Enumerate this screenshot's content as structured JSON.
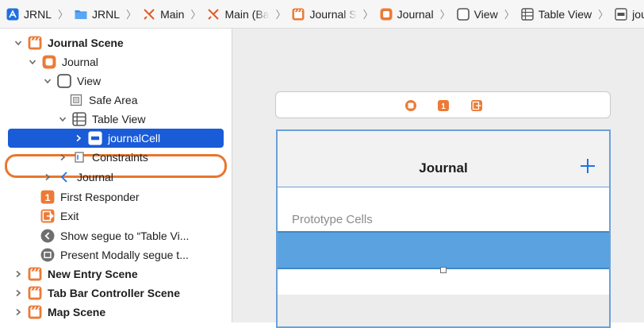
{
  "breadcrumb": [
    {
      "label": "JRNL",
      "icon": "xcode-project-icon"
    },
    {
      "label": "JRNL",
      "icon": "folder-icon"
    },
    {
      "label": "Main",
      "icon": "storyboard-icon"
    },
    {
      "label": "Main (Ba",
      "icon": "storyboard-icon"
    },
    {
      "label": "Journal S",
      "icon": "scene-icon"
    },
    {
      "label": "Journal",
      "icon": "view-controller-icon"
    },
    {
      "label": "View",
      "icon": "view-icon"
    },
    {
      "label": "Table View",
      "icon": "table-view-icon"
    },
    {
      "label": "journalCell",
      "icon": "table-cell-icon"
    }
  ],
  "outline": {
    "items": [
      {
        "label": "Journal Scene",
        "icon": "scene-icon",
        "disclosure": "open",
        "bold": true
      },
      {
        "label": "Journal",
        "icon": "view-controller-icon",
        "disclosure": "open"
      },
      {
        "label": "View",
        "icon": "view-icon",
        "disclosure": "open"
      },
      {
        "label": "Safe Area",
        "icon": "safe-area-icon",
        "disclosure": "none"
      },
      {
        "label": "Table View",
        "icon": "table-view-icon",
        "disclosure": "open"
      },
      {
        "label": "journalCell",
        "icon": "table-cell-icon",
        "disclosure": "closed",
        "selected": true
      },
      {
        "label": "Constraints",
        "icon": "constraints-icon",
        "disclosure": "closed"
      },
      {
        "label": "Journal",
        "icon": "back-chevron-icon",
        "disclosure": "closed"
      },
      {
        "label": "First Responder",
        "icon": "first-responder-icon",
        "disclosure": "none"
      },
      {
        "label": "Exit",
        "icon": "exit-icon",
        "disclosure": "none"
      },
      {
        "label": "Show segue to “Table Vi...",
        "icon": "segue-show-icon",
        "disclosure": "none"
      },
      {
        "label": "Present Modally segue t...",
        "icon": "segue-modal-icon",
        "disclosure": "none"
      },
      {
        "label": "New Entry Scene",
        "icon": "scene-icon",
        "disclosure": "closed",
        "bold": true
      },
      {
        "label": "Tab Bar Controller Scene",
        "icon": "scene-icon",
        "disclosure": "closed",
        "bold": true
      },
      {
        "label": "Map Scene",
        "icon": "scene-icon",
        "disclosure": "closed",
        "bold": true
      }
    ]
  },
  "canvas": {
    "nav_title": "Journal",
    "add_icon": "plus-icon",
    "section_label": "Prototype Cells"
  },
  "colors": {
    "selection": "#1a5bd8",
    "highlight_ring": "#e8772e",
    "scene_orange": "#e8772e",
    "cell_blue": "#5aa3e0",
    "accent_blue": "#1a73e8"
  }
}
